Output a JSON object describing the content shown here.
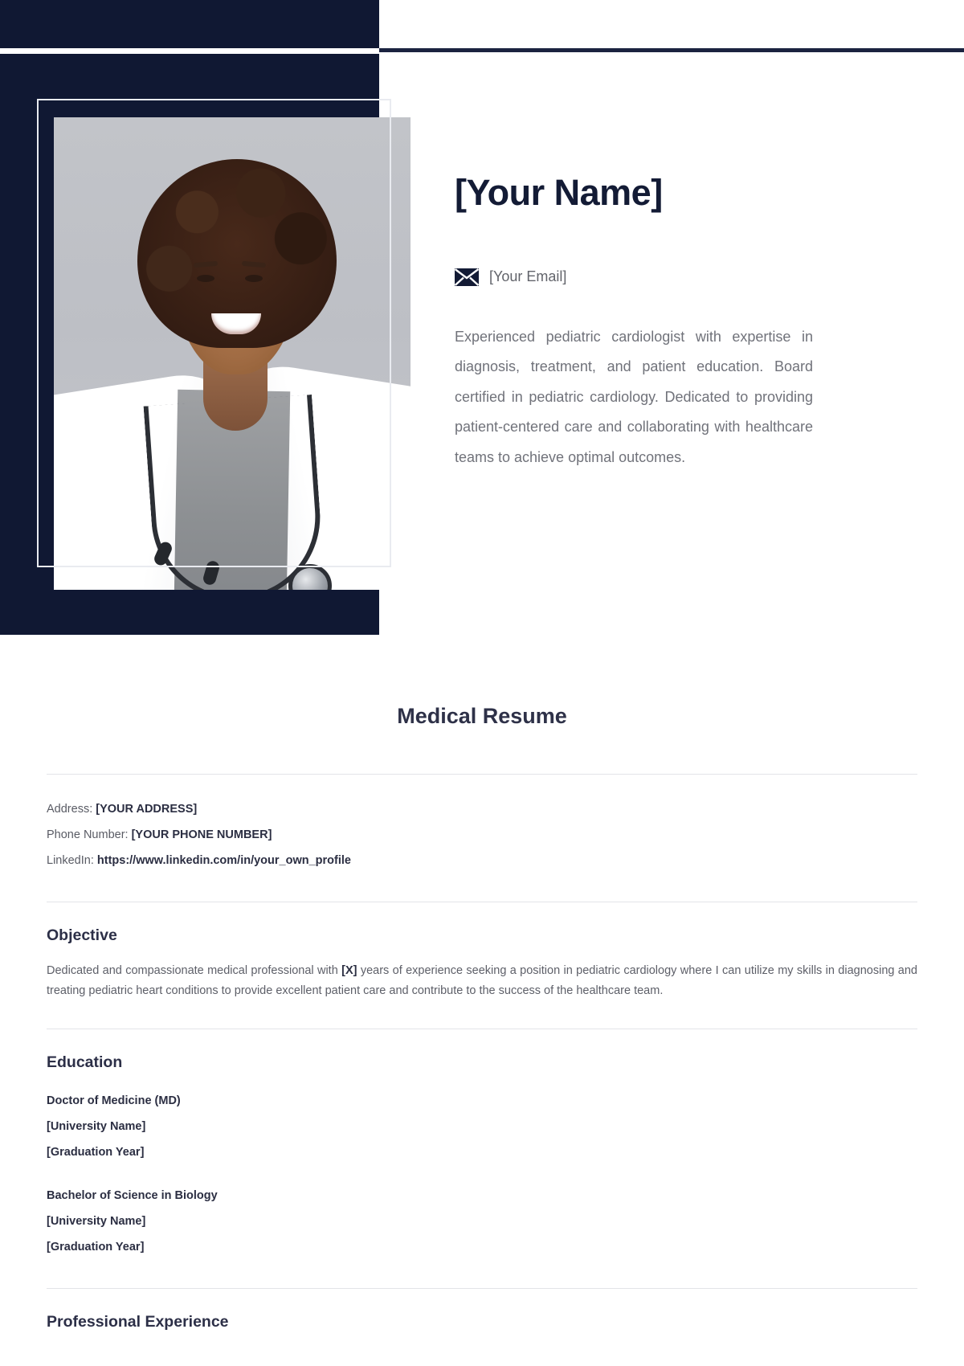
{
  "hero": {
    "name": "[Your Name]",
    "email_icon": "envelope-icon",
    "email": "[Your Email]",
    "summary": "Experienced pediatric cardiologist with expertise in diagnosis, treatment, and patient education. Board certified in pediatric cardiology. Dedicated to providing patient-centered care and collaborating with healthcare teams to achieve optimal outcomes.",
    "photo_alt": "Smiling female doctor in white lab coat with stethoscope"
  },
  "resume": {
    "title": "Medical Resume",
    "contact": [
      {
        "label": "Address:",
        "value": "[YOUR ADDRESS]"
      },
      {
        "label": "Phone Number:",
        "value": "[YOUR PHONE NUMBER]"
      },
      {
        "label": "LinkedIn:",
        "value": "https://www.linkedin.com/in/your_own_profile"
      }
    ],
    "objective": {
      "heading": "Objective",
      "text_before": "Dedicated and compassionate medical professional with ",
      "highlight": "[X]",
      "text_after": " years of experience seeking a position in pediatric cardiology where I can utilize my skills in diagnosing and treating pediatric heart conditions to provide excellent patient care and contribute to the success of the healthcare team."
    },
    "education": {
      "heading": "Education",
      "entries": [
        {
          "degree": "Doctor of Medicine (MD)",
          "university": "[University Name]",
          "year": "[Graduation Year]"
        },
        {
          "degree": "Bachelor of Science in Biology",
          "university": "[University Name]",
          "year": "[Graduation Year]"
        }
      ]
    },
    "experience": {
      "heading": "Professional Experience"
    }
  },
  "colors": {
    "navy": "#101833",
    "heading": "#2c2f47",
    "body_text": "#5d5f68",
    "muted": "#70727a",
    "divider": "#e3e4e8"
  }
}
